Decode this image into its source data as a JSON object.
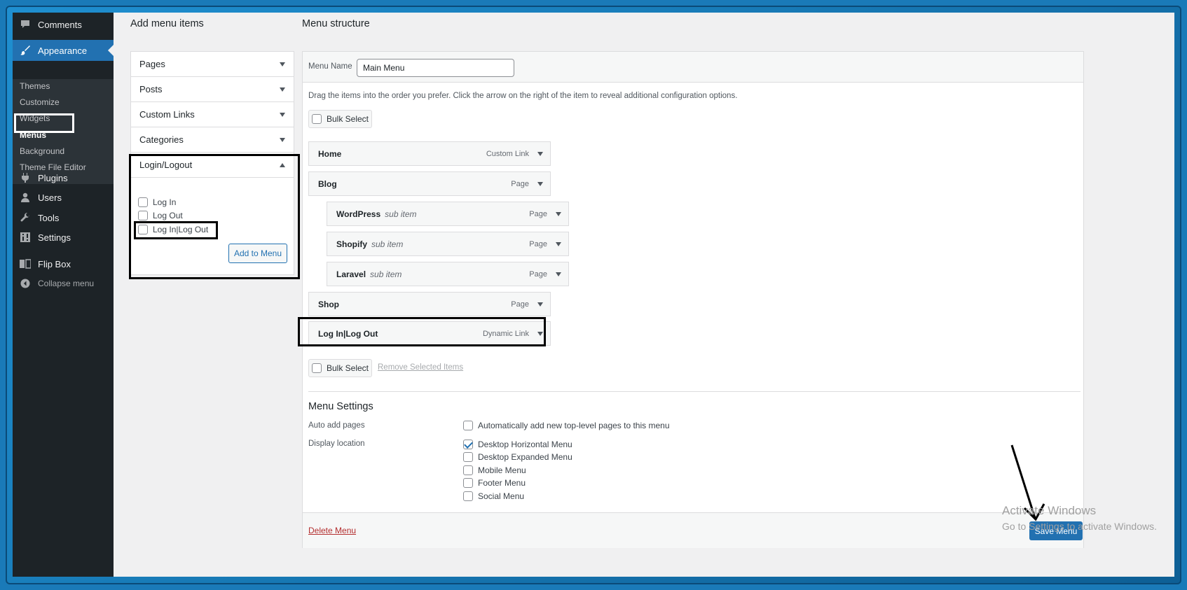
{
  "sidebar": {
    "comments": "Comments",
    "appearance": "Appearance",
    "submenu": [
      "Themes",
      "Customize",
      "Widgets",
      "Menus",
      "Background",
      "Theme File Editor"
    ],
    "plugins": "Plugins",
    "users": "Users",
    "tools": "Tools",
    "settings": "Settings",
    "flipbox": "Flip Box",
    "collapse": "Collapse menu"
  },
  "add_items": {
    "heading": "Add menu items",
    "sections": [
      "Pages",
      "Posts",
      "Custom Links",
      "Categories"
    ],
    "login_section": "Login/Logout",
    "options": [
      "Log In",
      "Log Out",
      "Log In|Log Out"
    ],
    "add_button": "Add to Menu"
  },
  "structure": {
    "heading": "Menu structure",
    "menu_name_label": "Menu Name",
    "menu_name_value": "Main Menu",
    "instructions": "Drag the items into the order you prefer. Click the arrow on the right of the item to reveal additional configuration options.",
    "bulk_select": "Bulk Select",
    "items": [
      {
        "title": "Home",
        "sub": "",
        "type": "Custom Link"
      },
      {
        "title": "Blog",
        "sub": "",
        "type": "Page"
      },
      {
        "title": "WordPress",
        "sub": "sub item",
        "type": "Page"
      },
      {
        "title": "Shopify",
        "sub": "sub item",
        "type": "Page"
      },
      {
        "title": "Laravel",
        "sub": "sub item",
        "type": "Page"
      },
      {
        "title": "Shop",
        "sub": "",
        "type": "Page"
      },
      {
        "title": "Log In|Log Out",
        "sub": "",
        "type": "Dynamic Link"
      }
    ],
    "remove_selected": "Remove Selected Items"
  },
  "settings": {
    "heading": "Menu Settings",
    "auto_add_label": "Auto add pages",
    "auto_add_option": "Automatically add new top-level pages to this menu",
    "display_label": "Display location",
    "locations": [
      {
        "label": "Desktop Horizontal Menu",
        "checked": true
      },
      {
        "label": "Desktop Expanded Menu",
        "checked": false
      },
      {
        "label": "Mobile Menu",
        "checked": false
      },
      {
        "label": "Footer Menu",
        "checked": false
      },
      {
        "label": "Social Menu",
        "checked": false
      }
    ]
  },
  "footer": {
    "delete": "Delete Menu",
    "save": "Save Menu"
  },
  "watermark": {
    "line1": "Activate Windows",
    "line2": "Go to Settings to activate Windows."
  },
  "colors": {
    "accent": "#2271b1",
    "sidebar": "#1d2327",
    "frame": "#1a7ab8"
  }
}
